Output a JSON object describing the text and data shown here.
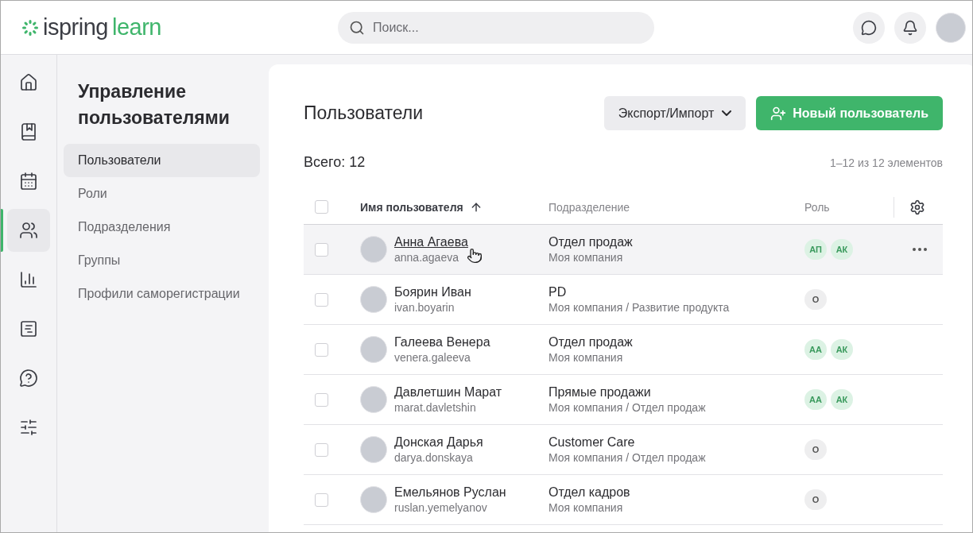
{
  "header": {
    "logo_word_1": "ispring",
    "logo_word_2": "learn",
    "search": {
      "placeholder": "Поиск..."
    }
  },
  "rail": [
    {
      "selected": false
    },
    {
      "selected": false
    },
    {
      "selected": false
    },
    {
      "selected": true
    },
    {
      "selected": false
    },
    {
      "selected": false
    },
    {
      "selected": false
    },
    {
      "selected": false
    }
  ],
  "sidebar": {
    "title": "Управление пользователями",
    "items": [
      {
        "label": "Пользователи",
        "selected": true
      },
      {
        "label": "Роли",
        "selected": false
      },
      {
        "label": "Подразделения",
        "selected": false
      },
      {
        "label": "Группы",
        "selected": false
      },
      {
        "label": "Профили саморегистрации",
        "selected": false
      }
    ]
  },
  "main": {
    "title": "Пользователи",
    "export_button": "Экспорт/Импорт",
    "new_button": "Новый пользователь",
    "total": "Всего: 12",
    "range": "1–12 из 12 элементов"
  },
  "table": {
    "all_checked": false,
    "columns": [
      "Имя пользователя",
      "Подразделение",
      "Роль"
    ],
    "rows": [
      {
        "name": "Анна Агаева",
        "login": "anna.agaeva",
        "department": "Отдел продаж",
        "path": "Моя компания",
        "hovered": true,
        "checked": false,
        "roles": [
          {
            "label": "АП",
            "color": "#dcf2e4"
          },
          {
            "label": "АК",
            "color": "#dcf2e4"
          }
        ]
      },
      {
        "name": "Боярин Иван",
        "login": "ivan.boyarin",
        "department": "PD",
        "path": "Моя компания / Развитие продукта",
        "hovered": false,
        "checked": false,
        "roles": [
          {
            "label": "О",
            "color": "#eeeeef"
          }
        ]
      },
      {
        "name": "Галеева Венера",
        "login": "venera.galeeva",
        "department": "Отдел продаж",
        "path": "Моя компания",
        "hovered": false,
        "checked": false,
        "roles": [
          {
            "label": "АА",
            "color": "#dcf2e4"
          },
          {
            "label": "АК",
            "color": "#dcf2e4"
          }
        ]
      },
      {
        "name": "Давлетшин Марат",
        "login": "marat.davletshin",
        "department": "Прямые продажи",
        "path": "Моя компания / Отдел продаж",
        "hovered": false,
        "checked": false,
        "roles": [
          {
            "label": "АА",
            "color": "#dcf2e4"
          },
          {
            "label": "АК",
            "color": "#dcf2e4"
          }
        ]
      },
      {
        "name": "Донская Дарья",
        "login": "darya.donskaya",
        "department": "Customer Care",
        "path": "Моя компания / Отдел продаж",
        "hovered": false,
        "checked": false,
        "roles": [
          {
            "label": "О",
            "color": "#eeeeef"
          }
        ]
      },
      {
        "name": "Емельянов Руслан",
        "login": "ruslan.yemelyanov",
        "department": "Отдел кадров",
        "path": "Моя компания",
        "hovered": false,
        "checked": false,
        "roles": [
          {
            "label": "О",
            "color": "#eeeeef"
          }
        ]
      }
    ]
  }
}
